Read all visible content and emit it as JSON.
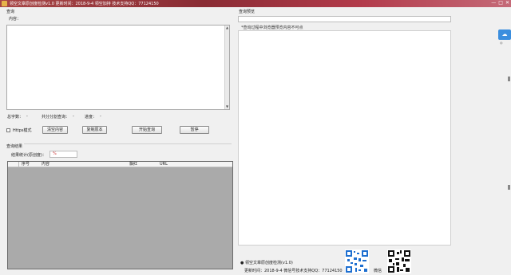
{
  "window": {
    "title": "领空文章原创度检测v1.0  更新时间：2018-9-4  领空加持 技术支持QQ：77124150",
    "controls": [
      "—",
      "□",
      "✕"
    ]
  },
  "query": {
    "section_label": "查询",
    "content_label": "内容：",
    "content_value": ""
  },
  "stats": {
    "total_words_label": "总字数：",
    "total_words_value": "-",
    "segments_label": "共分分割查询：",
    "segments_value": "-",
    "progress_label": "进度：",
    "progress_value": "-"
  },
  "options": {
    "https_label": "Https模式",
    "https_checked": false
  },
  "buttons": {
    "clear": "清空内容",
    "copy": "复制原本",
    "start": "开始查询",
    "pause": "暂停"
  },
  "results": {
    "section_label": "查询结果",
    "originality_label": "结果统计(原创度)：",
    "originality_value": "%",
    "columns": [
      "序号",
      "内容",
      "飘红",
      "URL"
    ]
  },
  "preview": {
    "section_label": "查询预览",
    "note": "*查询过程中浏览器预览内容不可点"
  },
  "footer": {
    "line1": "● 领空文章原创度检测(v1.0)",
    "line2": "更新时间：2018-9-4  微信号技术支持QQ：77124150",
    "wechat_label": "微信"
  },
  "side_panel": {
    "icon": "cloud-icon",
    "label": "◎"
  }
}
